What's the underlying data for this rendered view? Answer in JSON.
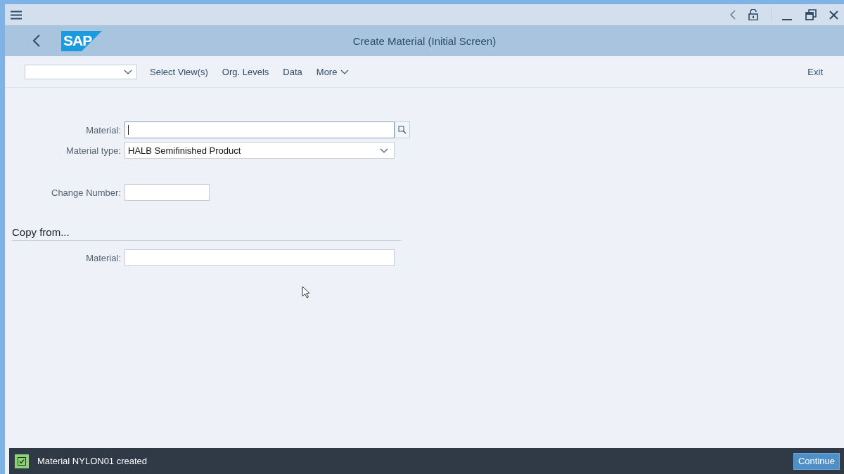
{
  "window": {
    "title": "Create Material (Initial Screen)",
    "logo": "SAP"
  },
  "toolbar": {
    "items": [
      "Select View(s)",
      "Org. Levels",
      "Data"
    ],
    "more": "More",
    "exit": "Exit"
  },
  "form": {
    "fields": [
      {
        "label": "Material:",
        "kind": "search",
        "focused": true
      },
      {
        "label": "Material type:",
        "value": "HALB Semifinished Product",
        "kind": "dropdown",
        "focused": false
      },
      {
        "label": "Change Number:",
        "kind": "short",
        "focused": false
      }
    ],
    "section": {
      "title": "Copy from...",
      "fields": [
        {
          "label": "Material:",
          "kind": "text",
          "focused": false
        }
      ]
    }
  },
  "status_bar": {
    "message": "Material NYLON01 created",
    "success": true,
    "button": "Continue"
  }
}
